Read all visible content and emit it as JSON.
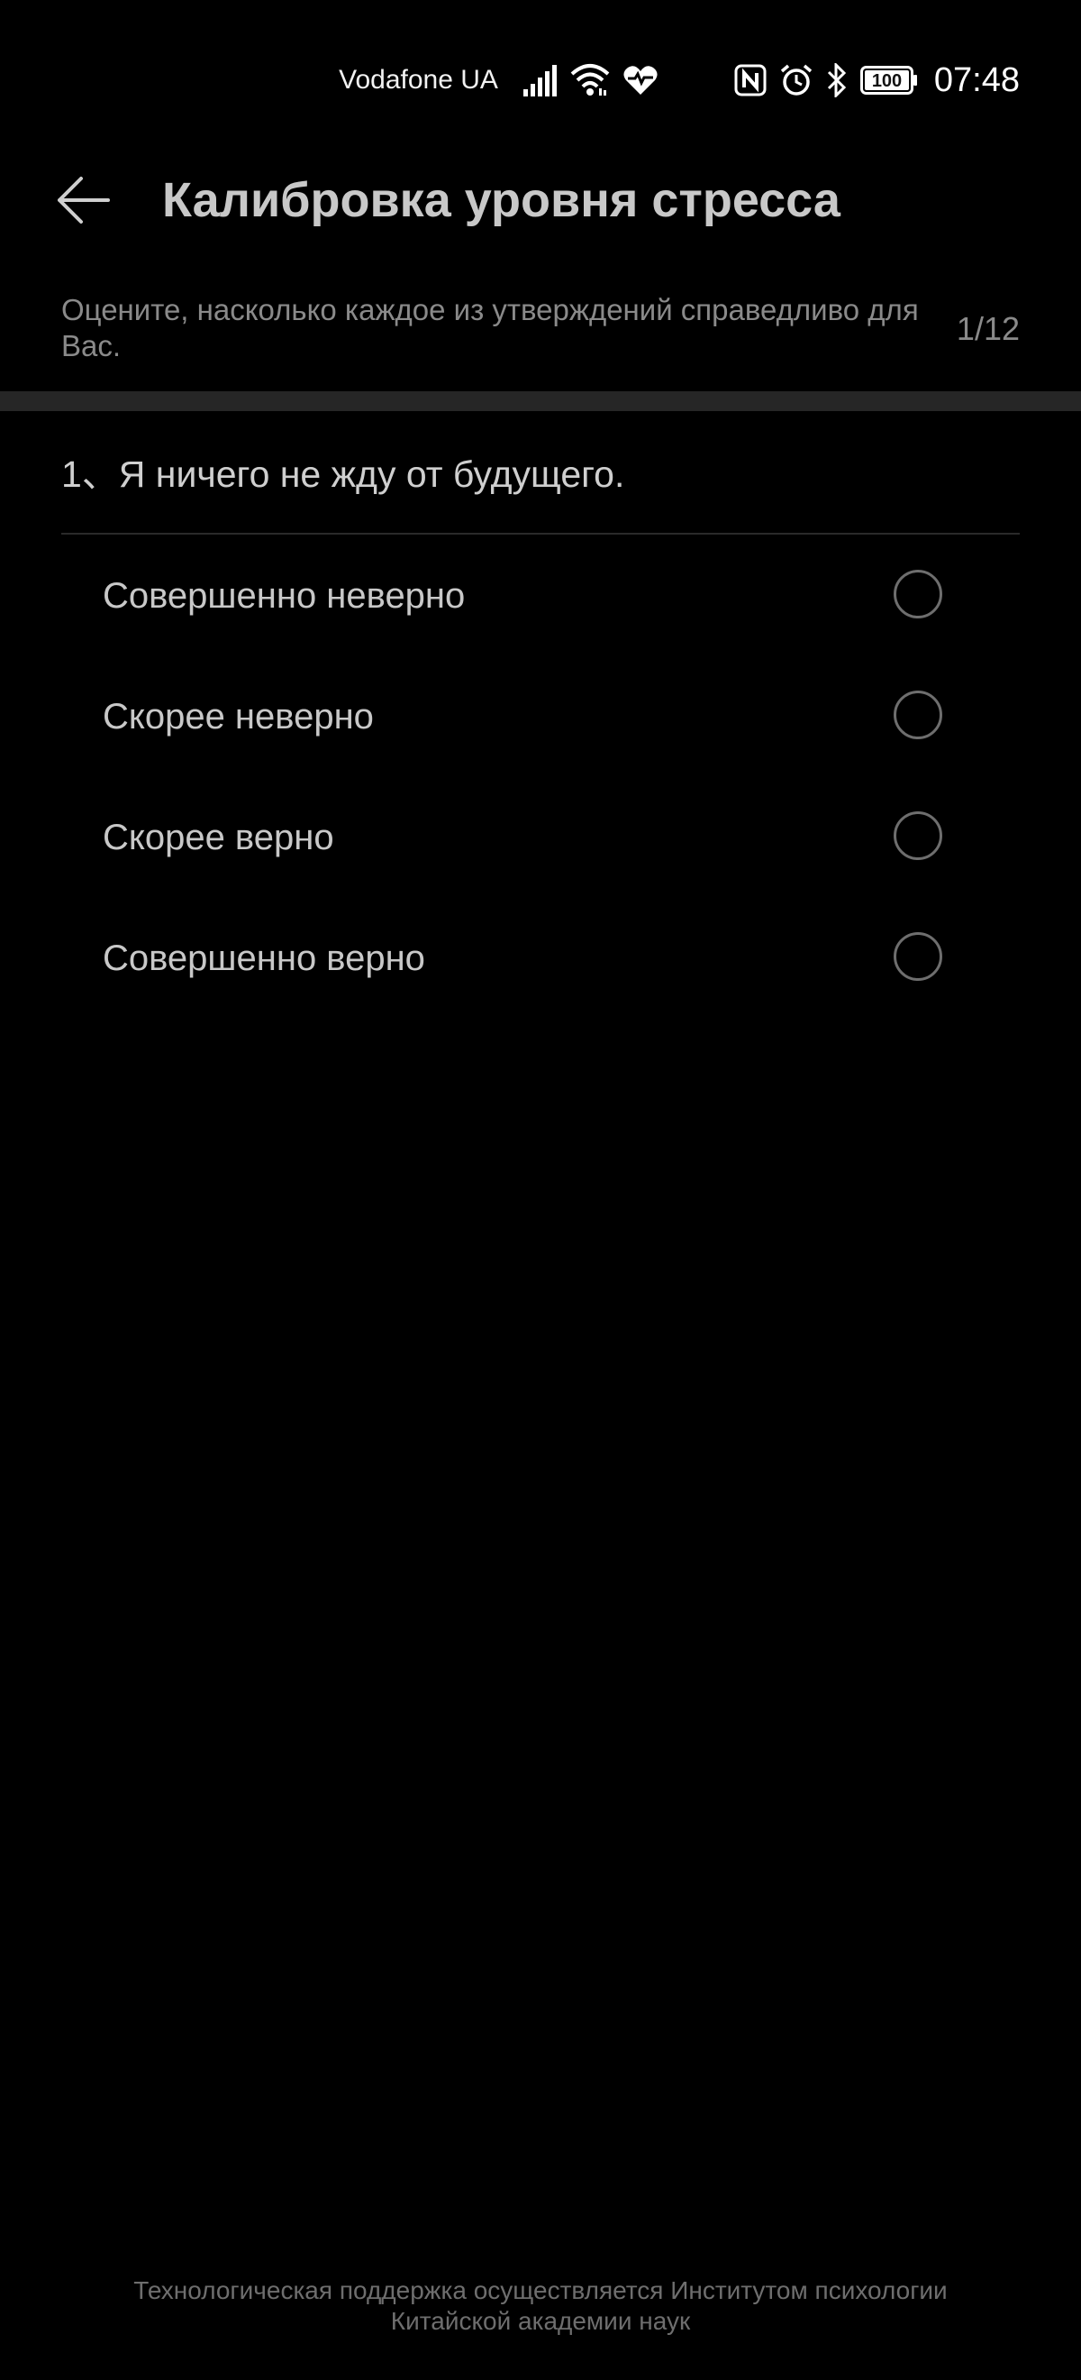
{
  "status_bar": {
    "carrier": "Vodafone UA",
    "battery": "100",
    "time": "07:48",
    "icons": [
      "signal-icon",
      "wifi-icon",
      "heart-rate-icon",
      "nfc-icon",
      "alarm-icon",
      "bluetooth-icon",
      "battery-icon"
    ]
  },
  "header": {
    "title": "Калибровка уровня стресса",
    "back_icon": "arrow-left-icon"
  },
  "instruction": {
    "text": "Оцените, насколько каждое из утверждений справедливо для Вас.",
    "progress": "1/12"
  },
  "question": {
    "text": "1、Я ничего не жду от будущего.",
    "options": [
      {
        "label": "Совершенно неверно",
        "selected": false
      },
      {
        "label": "Скорее неверно",
        "selected": false
      },
      {
        "label": "Скорее верно",
        "selected": false
      },
      {
        "label": "Совершенно верно",
        "selected": false
      }
    ]
  },
  "footer": {
    "line1": "Технологическая поддержка осуществляется Институтом психологии",
    "line2": "Китайской академии наук"
  },
  "colors": {
    "background": "#000000",
    "title": "#c8c8c8",
    "secondary_text": "#8a8a8a",
    "radio_border": "#6e6e6e"
  }
}
